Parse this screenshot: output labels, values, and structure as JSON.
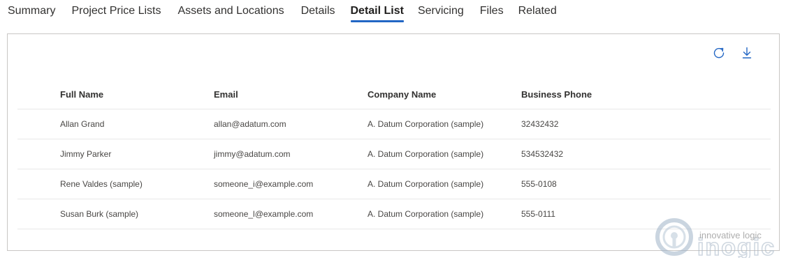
{
  "tabs": [
    {
      "label": "Summary",
      "active": false
    },
    {
      "label": "Project Price Lists",
      "active": false
    },
    {
      "label": "Assets and Locations",
      "active": false
    },
    {
      "label": "Details",
      "active": false
    },
    {
      "label": "Detail List",
      "active": true
    },
    {
      "label": "Servicing",
      "active": false
    },
    {
      "label": "Files",
      "active": false
    },
    {
      "label": "Related",
      "active": false
    }
  ],
  "toolbar": {
    "refresh_icon": "refresh-icon",
    "download_icon": "download-icon",
    "icon_color": "#2266c4"
  },
  "table": {
    "headers": [
      "Full Name",
      "Email",
      "Company Name",
      "Business Phone"
    ],
    "rows": [
      [
        "Allan Grand",
        "allan@adatum.com",
        "A. Datum Corporation (sample)",
        "32432432"
      ],
      [
        "Jimmy Parker",
        "jimmy@adatum.com",
        "A. Datum Corporation (sample)",
        "534532432"
      ],
      [
        "Rene Valdes (sample)",
        "someone_i@example.com",
        "A. Datum Corporation (sample)",
        "555-0108"
      ],
      [
        "Susan Burk (sample)",
        "someone_l@example.com",
        "A. Datum Corporation (sample)",
        "555-0111"
      ]
    ]
  },
  "watermark": {
    "tagline": "innovative logic",
    "brand": "inogic"
  },
  "colors": {
    "accent": "#2266c4",
    "border": "#c8c6c4",
    "row_divider": "#e8e8e8"
  }
}
